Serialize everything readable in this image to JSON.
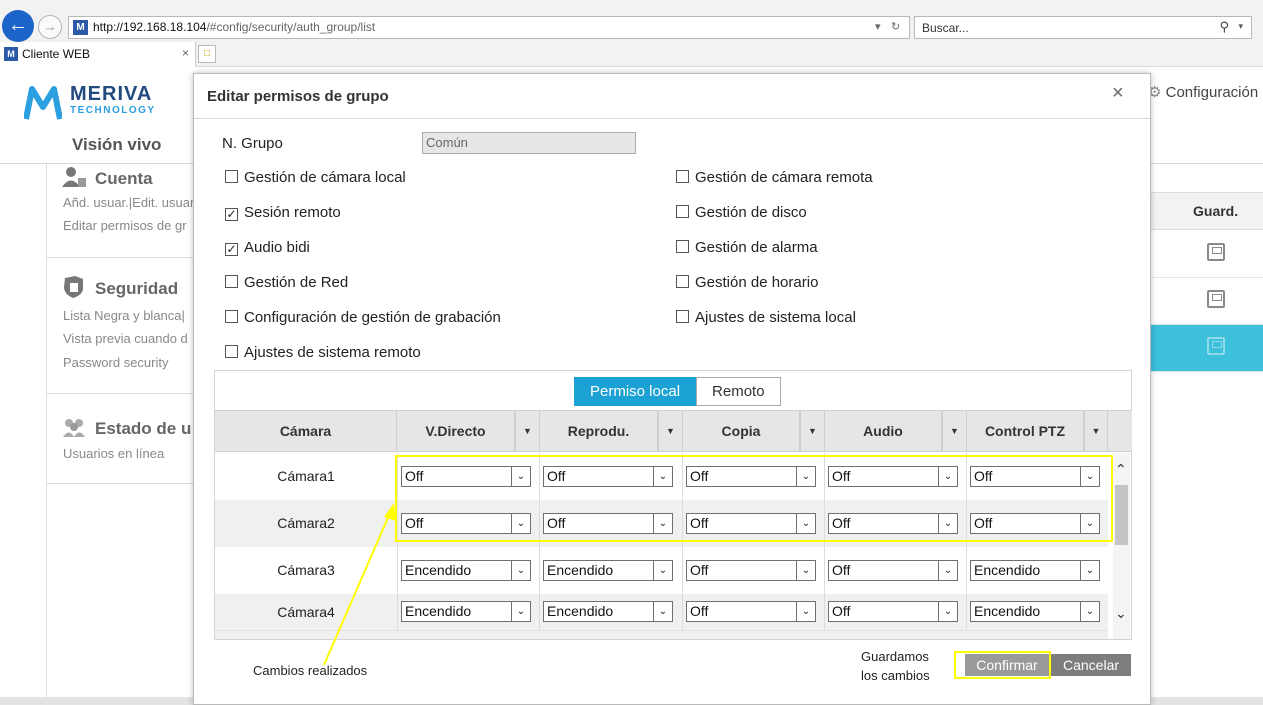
{
  "browser": {
    "url_host": "http://192.168.18.104",
    "url_path": "/#config/security/auth_group/list",
    "search_placeholder": "Buscar...",
    "tab_title": "Cliente WEB",
    "tab_close": "×"
  },
  "app": {
    "logo_top": "MERIVA",
    "logo_bottom": "TECHNOLOGY",
    "nav_live": "Visión vivo",
    "nav_config": "Configuración l"
  },
  "sidebar": {
    "cuenta": {
      "title": "Cuenta",
      "items": [
        "Añd. usuar.|Edit. usuar",
        "Editar permisos de gr"
      ]
    },
    "seguridad": {
      "title": "Seguridad",
      "items": [
        "Lista Negra y blanca|",
        "Vista previa cuando d",
        "Password security"
      ]
    },
    "estado": {
      "title": "Estado de u",
      "items": [
        "Usuarios en línea"
      ]
    }
  },
  "background_table": {
    "column_header": "Guard."
  },
  "modal": {
    "title": "Editar permisos de grupo",
    "close": "×",
    "group_label": "N. Grupo",
    "group_value": "Común",
    "permissions_left": [
      {
        "label": "Gestión de cámara local",
        "checked": false
      },
      {
        "label": "Sesión remoto",
        "checked": true
      },
      {
        "label": "Audio bidi",
        "checked": true
      },
      {
        "label": "Gestión de Red",
        "checked": false
      },
      {
        "label": "Configuración de gestión de grabación",
        "checked": false
      },
      {
        "label": "Ajustes de sistema remoto",
        "checked": false
      }
    ],
    "permissions_right": [
      {
        "label": "Gestión de cámara remota",
        "checked": false
      },
      {
        "label": "Gestión de disco",
        "checked": false
      },
      {
        "label": "Gestión de alarma",
        "checked": false
      },
      {
        "label": "Gestión de horario",
        "checked": false
      },
      {
        "label": "Ajustes de sistema local",
        "checked": false
      }
    ],
    "tabs": [
      "Permiso local",
      "Remoto"
    ],
    "columns": [
      "Cámara",
      "V.Directo",
      "Reprodu.",
      "Copia",
      "Audio",
      "Control PTZ"
    ],
    "rows": [
      {
        "camera": "Cámara1",
        "values": [
          "Off",
          "Off",
          "Off",
          "Off",
          "Off"
        ]
      },
      {
        "camera": "Cámara2",
        "values": [
          "Off",
          "Off",
          "Off",
          "Off",
          "Off"
        ]
      },
      {
        "camera": "Cámara3",
        "values": [
          "Encendido",
          "Encendido",
          "Off",
          "Off",
          "Encendido"
        ]
      },
      {
        "camera": "Cámara4",
        "values": [
          "Encendido",
          "Encendido",
          "Off",
          "Off",
          "Encendido"
        ]
      }
    ],
    "annotation_changes": "Cambios realizados",
    "annotation_save_1": "Guardamos",
    "annotation_save_2": "los cambios",
    "confirm": "Confirmar",
    "cancel": "Cancelar"
  },
  "colors": {
    "accent": "#1ca1d4",
    "highlight": "#ffff00",
    "selected_row": "#3cc0dc"
  }
}
